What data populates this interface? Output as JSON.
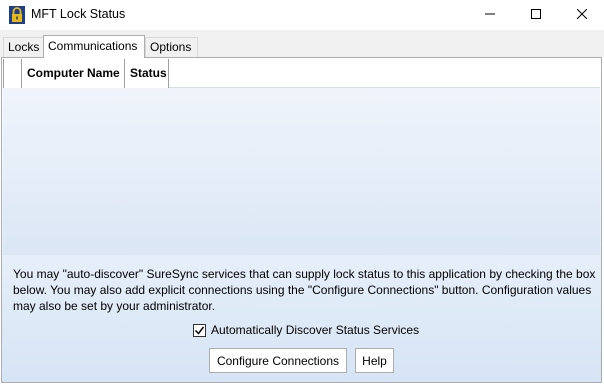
{
  "window": {
    "title": "MFT Lock Status",
    "icon": "padlock-icon",
    "controls": [
      "minimize-icon",
      "maximize-icon",
      "close-icon"
    ]
  },
  "tabs": [
    {
      "label": "Locks",
      "active": false
    },
    {
      "label": "Communications",
      "active": true
    },
    {
      "label": "Options",
      "active": false
    }
  ],
  "grid": {
    "columns": [
      "Computer Name",
      "Status"
    ],
    "rows": []
  },
  "description": "You may \"auto-discover\" SureSync services that can supply lock status to this application by checking the box below. You may also add explicit connections using the \"Configure Connections\" button. Configuration values may also be set by your administrator.",
  "auto_discover": {
    "label": "Automatically Discover Status Services",
    "checked": true
  },
  "buttons": {
    "configure": "Configure Connections",
    "help": "Help"
  },
  "colors": {
    "panel_gradient_top": "#ffffff",
    "panel_gradient_bottom": "#d6e4f5",
    "icon_blue": "#1e3f8a",
    "icon_gold": "#e8b818"
  }
}
